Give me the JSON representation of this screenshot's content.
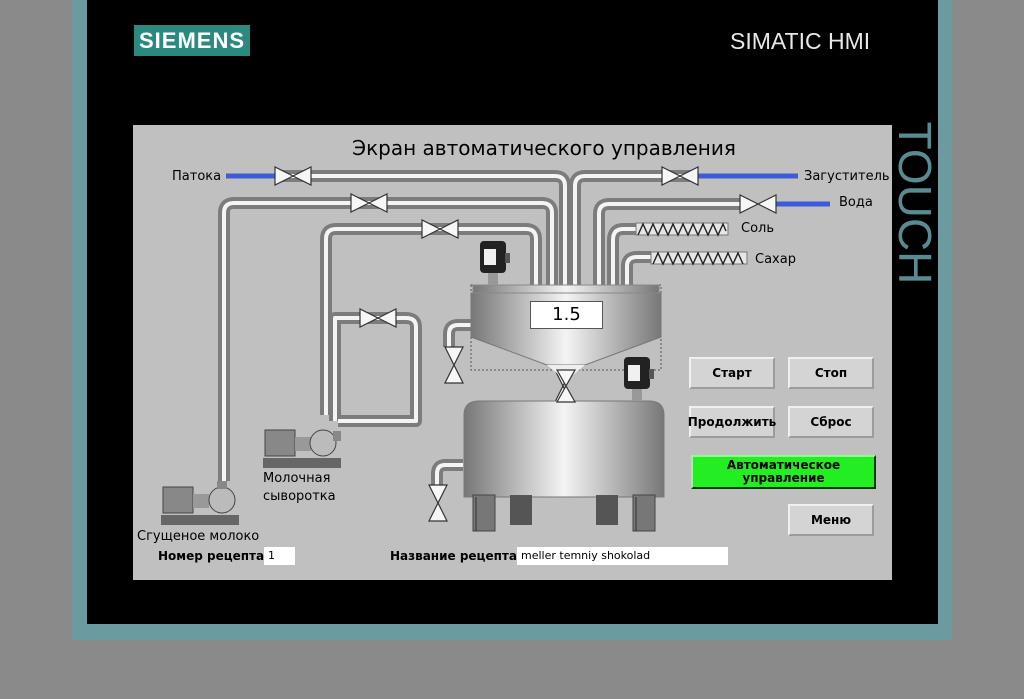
{
  "brand": {
    "logo": "SIEMENS",
    "product": "SIMATIC HMI",
    "touch": "TOUCH"
  },
  "screen": {
    "title": "Экран автоматического управления",
    "inputs": {
      "patoka": "Патока",
      "zagustitel": "Загуститель",
      "voda": "Вода",
      "sol": "Соль",
      "sahar": "Сахар"
    },
    "pumps": {
      "whey_line1": "Молочная",
      "whey_line2": "сыворотка",
      "condensed_milk": "Сгущеное молоко"
    },
    "tank_value": "1.5",
    "buttons": {
      "start": "Старт",
      "stop": "Стоп",
      "continue": "Продолжить",
      "reset": "Сброс",
      "auto_line1": "Автоматическое",
      "auto_line2": "управление",
      "menu": "Меню"
    },
    "recipe": {
      "number_label": "Номер рецепта",
      "number_value": "1",
      "name_label": "Название рецепта",
      "name_value": "meller temniy shokolad"
    }
  },
  "colors": {
    "auto_active": "#22ee22",
    "pipe_blue": "#3d5bd8"
  }
}
